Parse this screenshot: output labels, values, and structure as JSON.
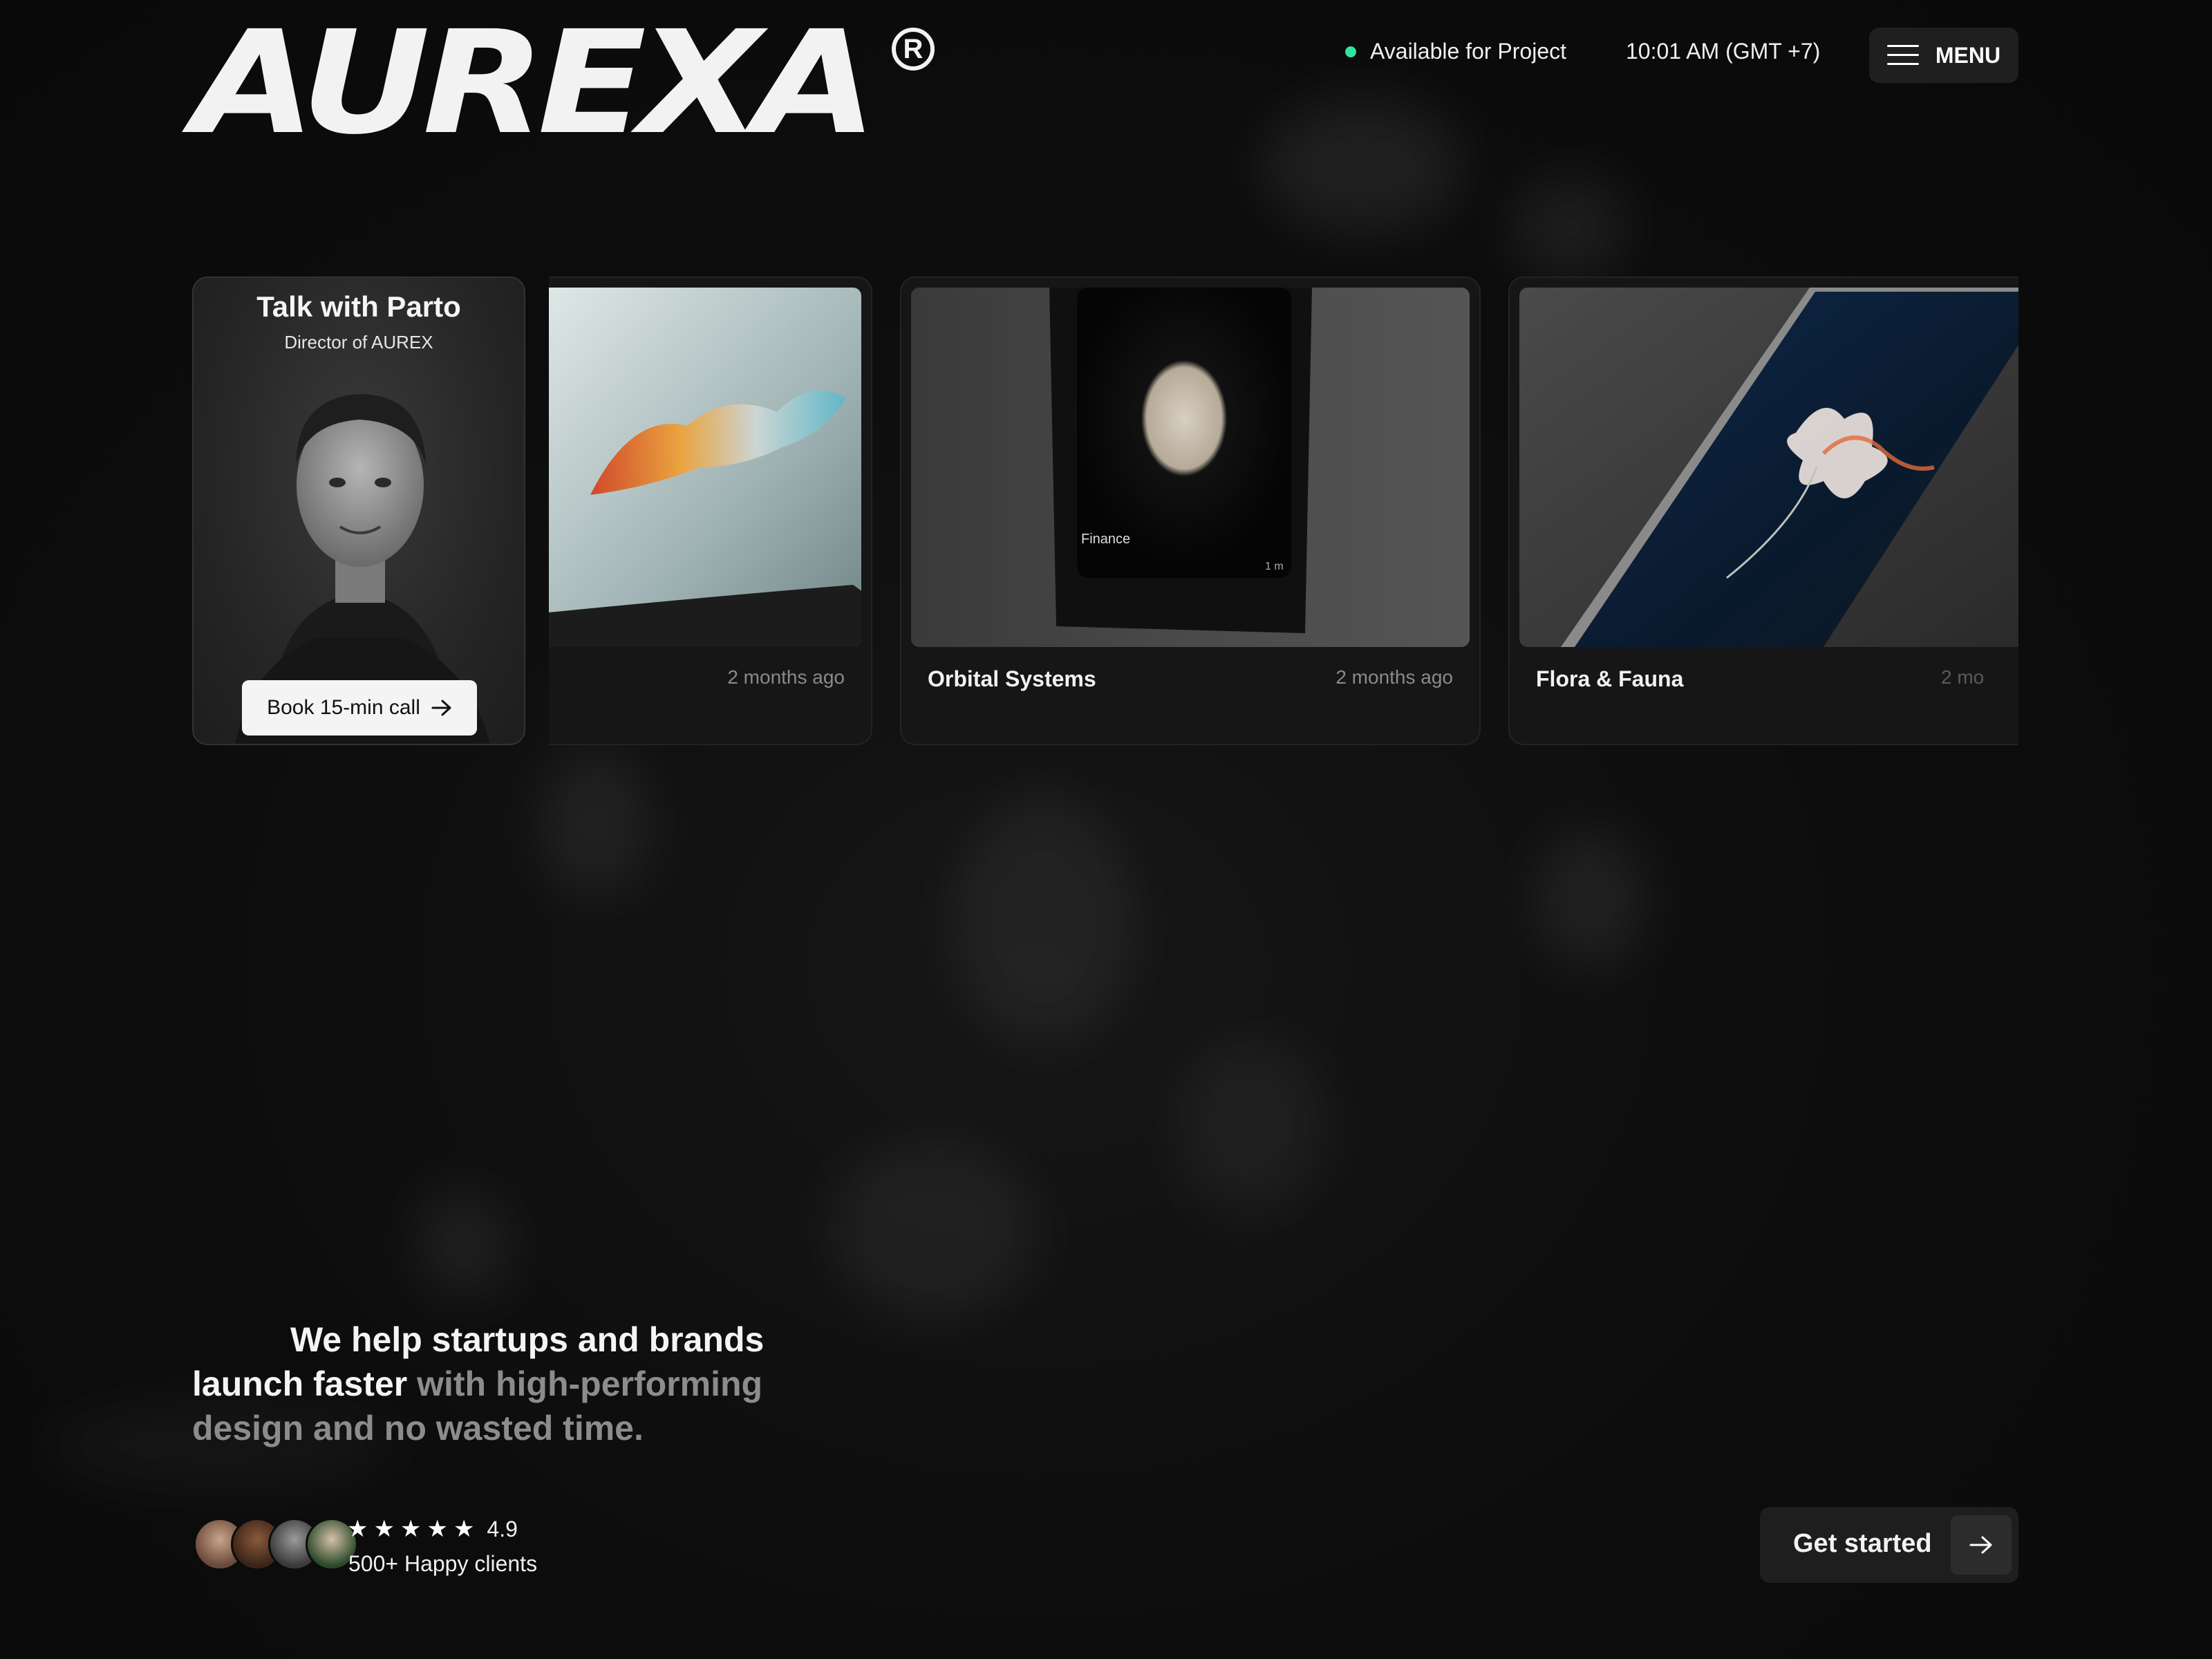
{
  "brand": {
    "name": "AUREXA",
    "registered": "R"
  },
  "header": {
    "status": "Available for Project",
    "clock": "10:01 AM (GMT +7)",
    "menu_label": "MENU",
    "status_color": "#2ee59d"
  },
  "talk_card": {
    "title": "Talk with Parto",
    "subtitle": "Director of AUREX",
    "button_label": "Book 15-min call"
  },
  "projects": [
    {
      "name": "",
      "time": "2 months ago"
    },
    {
      "name": "Orbital Systems",
      "time": "2 months ago",
      "screen_label": "Finance",
      "screen_meta": "1 m"
    },
    {
      "name": "Flora & Fauna",
      "time": "2 mo"
    }
  ],
  "hero": {
    "bright": "We help startups and brands launch faster",
    "dim": "with high-performing design and no wasted time."
  },
  "social_proof": {
    "rating": "4.9",
    "stars": 5,
    "clients": "500+ Happy clients"
  },
  "cta": {
    "label": "Get started"
  }
}
